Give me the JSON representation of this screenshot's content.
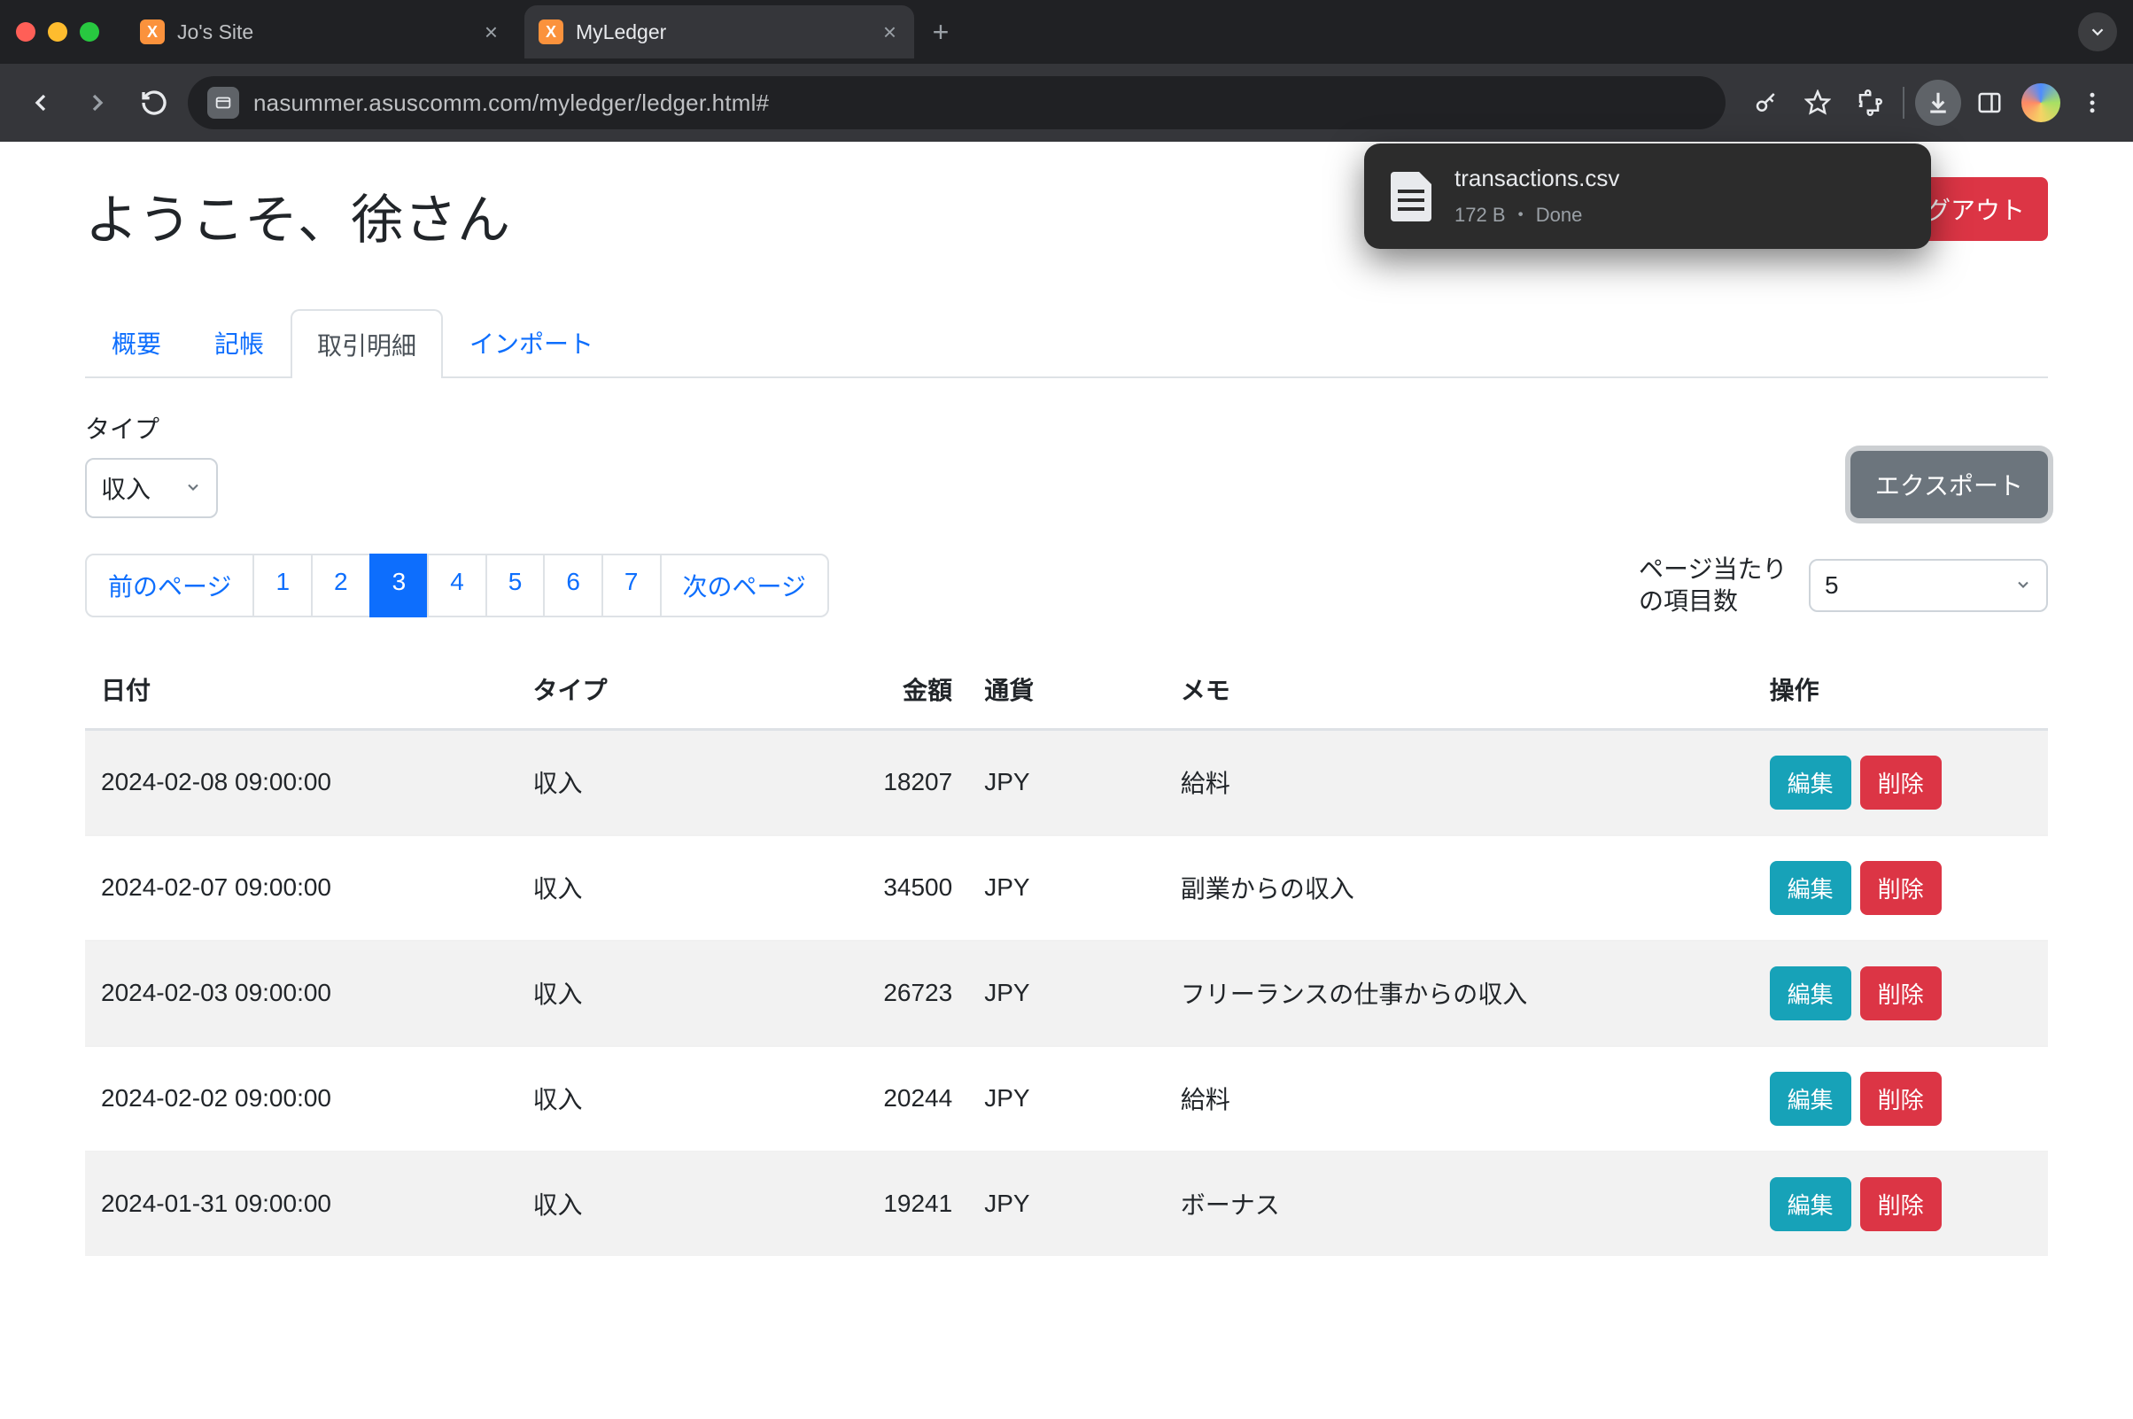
{
  "browser": {
    "tabs": [
      {
        "title": "Jo's Site",
        "active": false
      },
      {
        "title": "MyLedger",
        "active": true
      }
    ],
    "url": "nasummer.asuscomm.com/myledger/ledger.html#"
  },
  "download": {
    "filename": "transactions.csv",
    "meta": "172 B ・ Done"
  },
  "page": {
    "welcome": "ようこそ、徐さん",
    "logout": "ログアウト",
    "tabs": {
      "overview": "概要",
      "ledger": "記帳",
      "details": "取引明細",
      "import": "インポート"
    },
    "filter": {
      "type_label": "タイプ",
      "type_value": "収入"
    },
    "export_label": "エクスポート",
    "pagination": {
      "prev": "前のページ",
      "pages": [
        "1",
        "2",
        "3",
        "4",
        "5",
        "6",
        "7"
      ],
      "active_index": 2,
      "next": "次のページ"
    },
    "perpage": {
      "label": "ページ当たりの項目数",
      "value": "5"
    },
    "table": {
      "headers": {
        "date": "日付",
        "type": "タイプ",
        "amount": "金額",
        "currency": "通貨",
        "memo": "メモ",
        "actions": "操作"
      },
      "edit_label": "編集",
      "delete_label": "削除",
      "rows": [
        {
          "date": "2024-02-08 09:00:00",
          "type": "収入",
          "amount": "18207",
          "currency": "JPY",
          "memo": "給料"
        },
        {
          "date": "2024-02-07 09:00:00",
          "type": "収入",
          "amount": "34500",
          "currency": "JPY",
          "memo": "副業からの収入"
        },
        {
          "date": "2024-02-03 09:00:00",
          "type": "収入",
          "amount": "26723",
          "currency": "JPY",
          "memo": "フリーランスの仕事からの収入"
        },
        {
          "date": "2024-02-02 09:00:00",
          "type": "収入",
          "amount": "20244",
          "currency": "JPY",
          "memo": "給料"
        },
        {
          "date": "2024-01-31 09:00:00",
          "type": "収入",
          "amount": "19241",
          "currency": "JPY",
          "memo": "ボーナス"
        }
      ]
    }
  }
}
